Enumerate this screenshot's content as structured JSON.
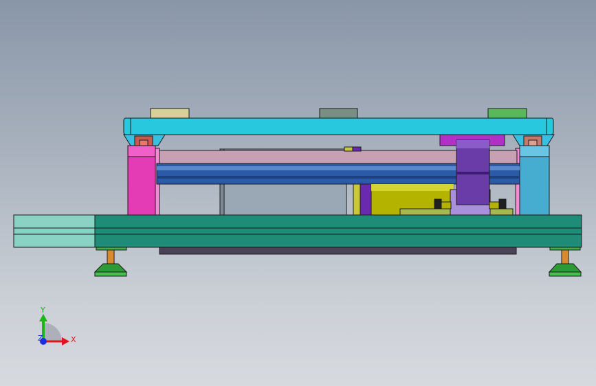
{
  "view": {
    "background_top": "#8996a8",
    "background_bottom": "#d7dadf"
  },
  "triad": {
    "x_label": "X",
    "y_label": "Y",
    "z_label": "Z",
    "x_color": "#e0141e",
    "y_color": "#18b818",
    "z_color": "#1a2ee0"
  },
  "assembly": {
    "top_plate_color": "#28c8de",
    "base_plate_color": "#1f8c78",
    "left_support_color": "#e43cb4",
    "right_support_color": "#46acd0",
    "rod_color": "#2b5aa8",
    "cylinder_color": "#b4b400",
    "clamp_color": "#6a3ca8"
  }
}
